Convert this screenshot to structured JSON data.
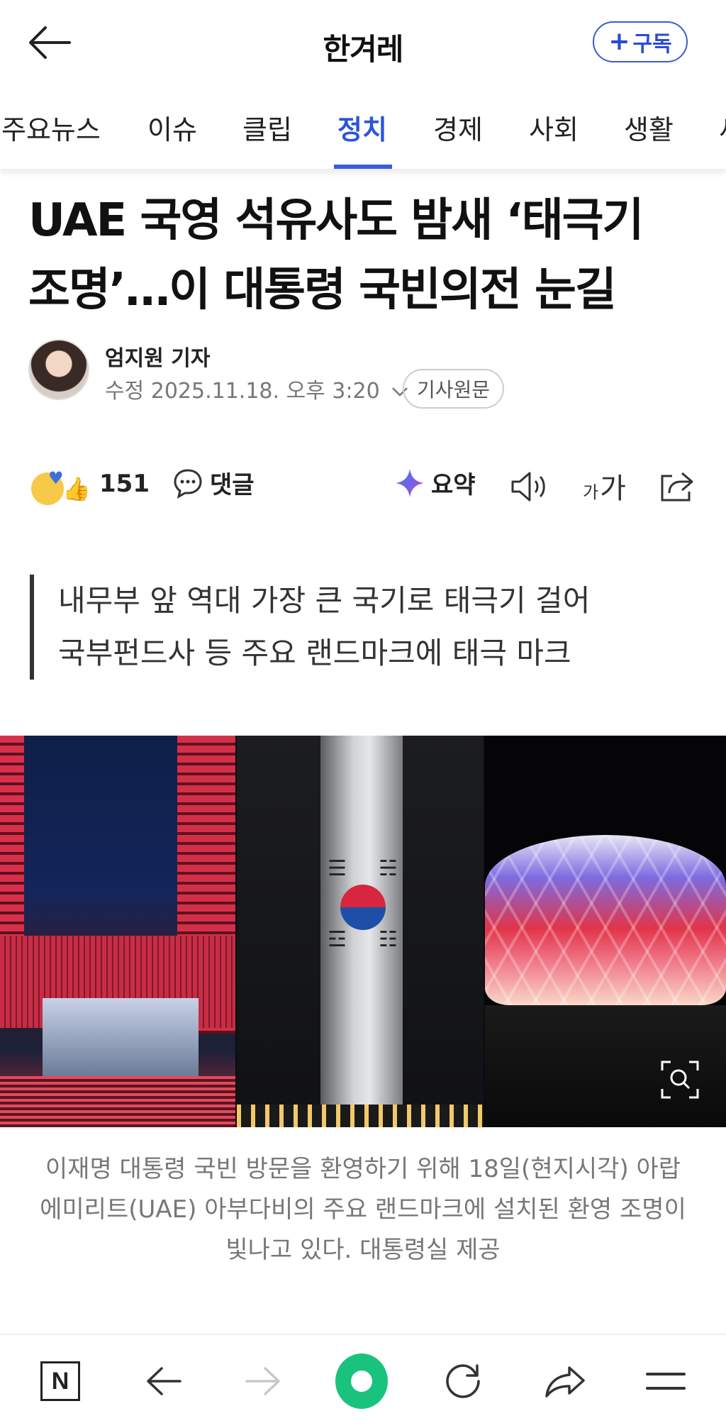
{
  "header": {
    "brand": "한겨레",
    "subscribe_label": "구독",
    "subscribe_plus": "+"
  },
  "tabs": [
    {
      "label": "주요뉴스",
      "active": false
    },
    {
      "label": "이슈",
      "active": false
    },
    {
      "label": "클립",
      "active": false
    },
    {
      "label": "정치",
      "active": true
    },
    {
      "label": "경제",
      "active": false
    },
    {
      "label": "사회",
      "active": false
    },
    {
      "label": "생활",
      "active": false
    },
    {
      "label": "세",
      "active": false
    }
  ],
  "article": {
    "headline_line1": "UAE 국영 석유사도 밤새 ‘태극기",
    "headline_line2": "조명’…이 대통령 국빈의전 눈길",
    "reporter": "엄지원 기자",
    "updated": "수정 2025.11.18. 오후 3:20",
    "original_label": "기사원문",
    "reaction_count": "151",
    "comment_label": "댓글",
    "summary_label": "요약",
    "font_small": "가",
    "font_large": "가",
    "subhead_line1": "내무부 앞 역대 가장 큰 국기로 태극기 걸어",
    "subhead_line2": "국부펀드사 등 주요 랜드마크에 태극 마크",
    "caption": "이재명 대통령 국빈 방문을 환영하기 위해 18일(현지시각) 아랍에미리트(UAE) 아부다비의 주요 랜드마크에 설치된 환영 조명이 빛나고 있다. 대통령실 제공"
  },
  "bottom_bar": {
    "home_logo": "N"
  },
  "colors": {
    "accent": "#2a55d9",
    "subscribe_border": "#3a5bd9",
    "green_button": "#19c37d"
  }
}
